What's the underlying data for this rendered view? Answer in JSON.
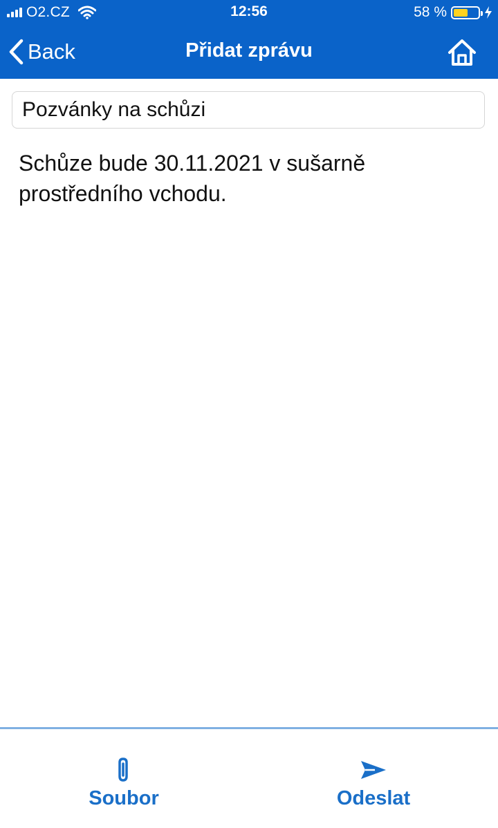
{
  "status_bar": {
    "carrier": "O2.CZ",
    "time": "12:56",
    "battery_percent": "58 %",
    "battery_level": 0.58,
    "battery_color": "#ffd21f"
  },
  "nav": {
    "back_label": "Back",
    "title": "Přidat zprávu"
  },
  "form": {
    "subject_value": "Pozvánky na schůzi",
    "body_text": "Schůze bude 30.11.2021 v sušarně prostředního vchodu."
  },
  "toolbar": {
    "attach_label": "Soubor",
    "send_label": "Odeslat"
  },
  "colors": {
    "primary": "#0a63c9",
    "action_text": "#1a6fc8",
    "divider": "#7fb0e2"
  },
  "icons": [
    "back-chevron-icon",
    "home-icon",
    "paperclip-icon",
    "send-icon",
    "wifi-icon",
    "signal-icon",
    "battery-icon",
    "charging-bolt-icon"
  ]
}
